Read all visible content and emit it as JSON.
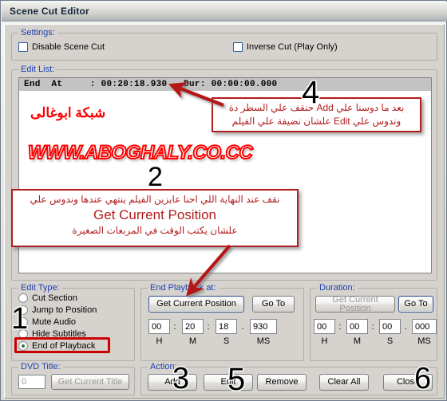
{
  "window": {
    "title": "Scene Cut Editor"
  },
  "settings": {
    "legend": "Settings:",
    "disable_scene_cut": {
      "label": "Disable Scene Cut",
      "checked": false
    },
    "inverse_cut": {
      "label": "Inverse Cut (Play Only)",
      "checked": false
    }
  },
  "edit_list": {
    "legend": "Edit List:",
    "items": [
      {
        "text": "End  At     : 00:20:18.930 - Dur: 00:00:00.000",
        "selected": true
      }
    ]
  },
  "edit_type": {
    "legend": "Edit Type:",
    "options": [
      {
        "label": "Cut Section",
        "selected": false
      },
      {
        "label": "Jump to Position",
        "selected": false
      },
      {
        "label": "Mute Audio",
        "selected": false
      },
      {
        "label": "Hide Subtitles",
        "selected": false
      },
      {
        "label": "End of Playback",
        "selected": true
      }
    ]
  },
  "dvd_title": {
    "legend": "DVD Title:",
    "value": "0",
    "get_current_title_label": "Get Current Title"
  },
  "end_playback": {
    "legend": "End Playback at:",
    "get_current_position_label": "Get Current Position",
    "go_to_label": "Go To",
    "time": {
      "h": "00",
      "m": "20",
      "s": "18",
      "ms": "930"
    },
    "units": {
      "h": "H",
      "m": "M",
      "s": "S",
      "ms": "MS"
    },
    "separators": {
      "hm": ":",
      "ms": ":",
      "sms": "."
    }
  },
  "duration": {
    "legend": "Duration:",
    "get_current_position_label": "Get Current Position",
    "go_to_label": "Go To",
    "time": {
      "h": "00",
      "m": "00",
      "s": "00",
      "ms": "000"
    },
    "units": {
      "h": "H",
      "m": "M",
      "s": "S",
      "ms": "MS"
    },
    "separators": {
      "hm": ":",
      "ms": ":",
      "sms": "."
    }
  },
  "action": {
    "legend": "Action:",
    "add_label": "Add",
    "edit_label": "Edit",
    "remove_label": "Remove",
    "clear_all_label": "Clear All",
    "close_label": "Close"
  },
  "annotations": {
    "watermark_arabic": "شبكة ابوغالى",
    "watermark_url": "WWW.ABOGHALY.CO.CC",
    "box_top": {
      "line1": "بعد ما دوسنا علي Add حنقف علي السطر دة",
      "line2": "وندوس علي Edit علشان نضيفة علي الفيلم"
    },
    "box_mid": {
      "line1": "نقف عند النهاية اللي احنا عايزين الفيلم ينتهي عندها وندوس علي",
      "line2": "Get Current Position",
      "line3": "علشان يكتب الوقت في المربعات الصغيرة"
    },
    "steps": {
      "one": "1",
      "two": "2",
      "three": "3",
      "four": "4",
      "five": "5",
      "six": "6"
    },
    "colors": {
      "annotation_red": "#b21d1d",
      "watermark_red": "#ff0000",
      "highlight_red": "#cc0000",
      "legend_blue": "#1e3faf"
    }
  }
}
